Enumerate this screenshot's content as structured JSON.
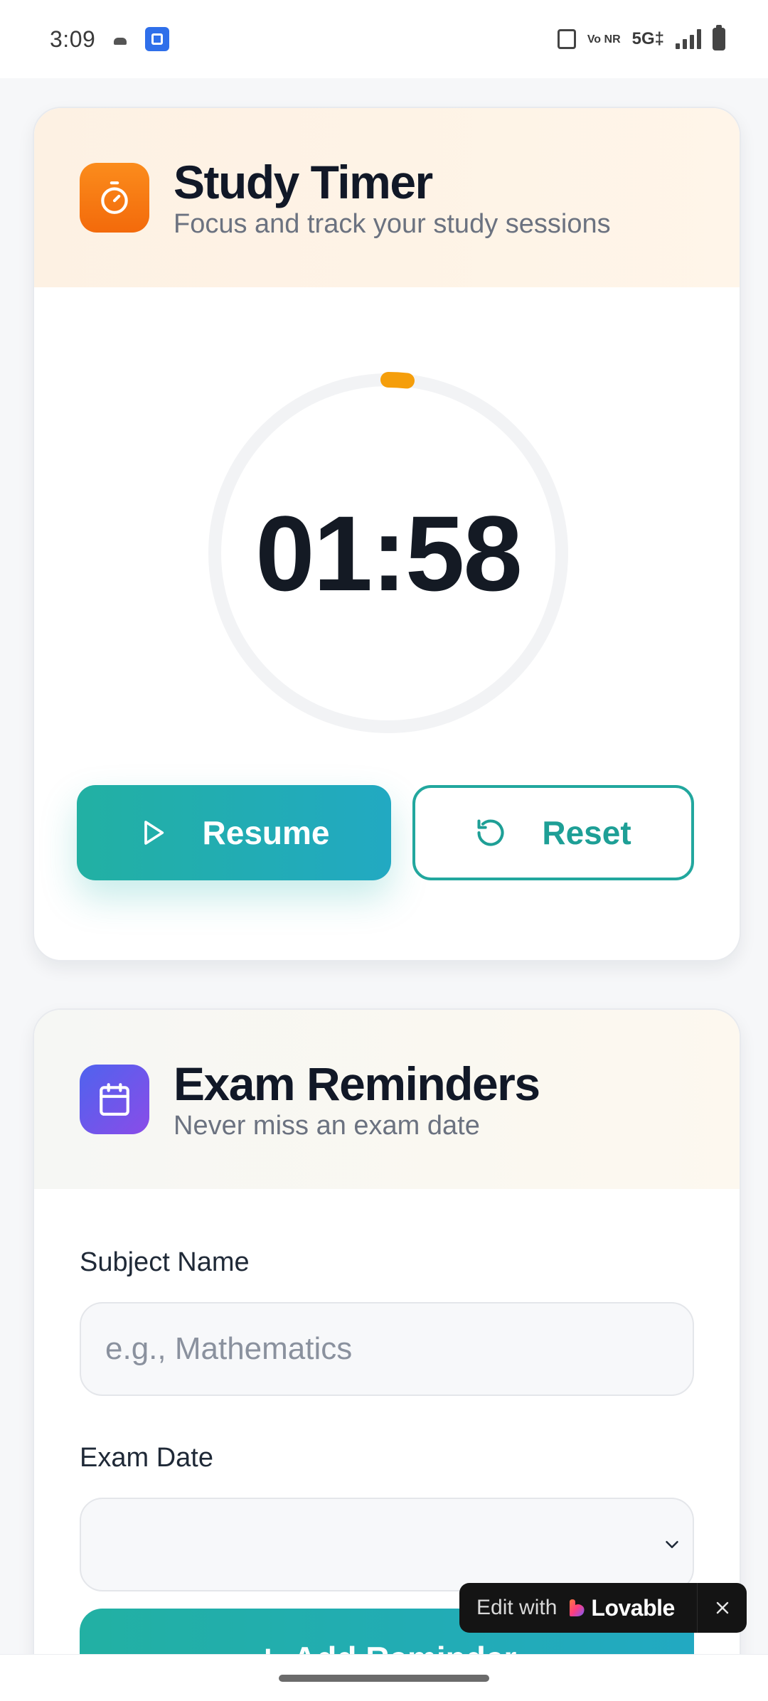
{
  "status_bar": {
    "time": "3:09",
    "network_vonr": "Vo NR",
    "network_5g": "5G‡"
  },
  "timer_card": {
    "title": "Study Timer",
    "subtitle": "Focus and track your study sessions",
    "icon": "stopwatch-icon",
    "time_display": "01:58",
    "progress_fraction": 0.017,
    "resume_label": "Resume",
    "reset_label": "Reset",
    "colors": {
      "accent": "#f59e0b",
      "teal": "#22b0a3",
      "orange": "#f97316"
    }
  },
  "exam_card": {
    "title": "Exam Reminders",
    "subtitle": "Never miss an exam date",
    "icon": "calendar-icon",
    "subject_label": "Subject Name",
    "subject_placeholder": "e.g., Mathematics",
    "date_label": "Exam Date",
    "date_value": "",
    "add_button_label": "Add Reminder",
    "colors": {
      "indigo": "#4f63ee",
      "purple": "#8a4ce8"
    }
  },
  "lovable_badge": {
    "prefix": "Edit with",
    "brand": "Lovable"
  }
}
